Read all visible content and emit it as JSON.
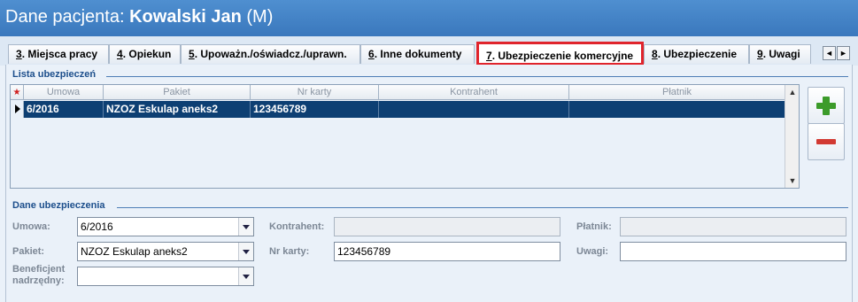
{
  "window": {
    "title_prefix": "Dane pacjenta: ",
    "patient_name": "Kowalski Jan",
    "patient_suffix": " (M)"
  },
  "tabs": [
    {
      "key": "3",
      "label": ". Miejsca pracy"
    },
    {
      "key": "4",
      "label": ". Opiekun"
    },
    {
      "key": "5",
      "label": ". Upoważn./oświadcz./uprawn."
    },
    {
      "key": "6",
      "label": ". Inne dokumenty"
    },
    {
      "key": "7",
      "label": ". Ubezpieczenie komercyjne"
    },
    {
      "key": "8",
      "label": ". Ubezpieczenie"
    },
    {
      "key": "9",
      "label": ". Uwagi"
    }
  ],
  "tab_scroll": {
    "left": "◄",
    "right": "►"
  },
  "insurance_list": {
    "title": "Lista ubezpieczeń",
    "columns": [
      "Umowa",
      "Pakiet",
      "Nr karty",
      "Kontrahent",
      "Płatnik"
    ],
    "required_marker": "★",
    "rows": [
      {
        "umowa": "6/2016",
        "pakiet": "NZOZ Eskulap aneks2",
        "nr_karty": "123456789",
        "kontrahent": "",
        "platnik": ""
      }
    ],
    "scroll_up": "▲",
    "scroll_down": "▼"
  },
  "insurance_details": {
    "title": "Dane ubezpieczenia",
    "umowa_label": "Umowa:",
    "umowa_value": "6/2016",
    "pakiet_label": "Pakiet:",
    "pakiet_value": "NZOZ Eskulap aneks2",
    "beneficjent_label_1": "Beneficjent",
    "beneficjent_label_2": "nadrzędny:",
    "beneficjent_value": "",
    "kontrahent_label": "Kontrahent:",
    "kontrahent_value": "",
    "nr_karty_label": "Nr karty:",
    "nr_karty_value": "123456789",
    "platnik_label": "Płatnik:",
    "platnik_value": "",
    "uwagi_label": "Uwagi:",
    "uwagi_value": ""
  },
  "colors": {
    "title_bar": "#3a78bd",
    "active_tab_border": "#e0242c",
    "selected_row": "#0d3f73",
    "add_icon": "#3c9b2a",
    "remove_icon": "#d23a32"
  },
  "icons": {
    "add": "plus-icon",
    "remove": "minus-icon"
  }
}
